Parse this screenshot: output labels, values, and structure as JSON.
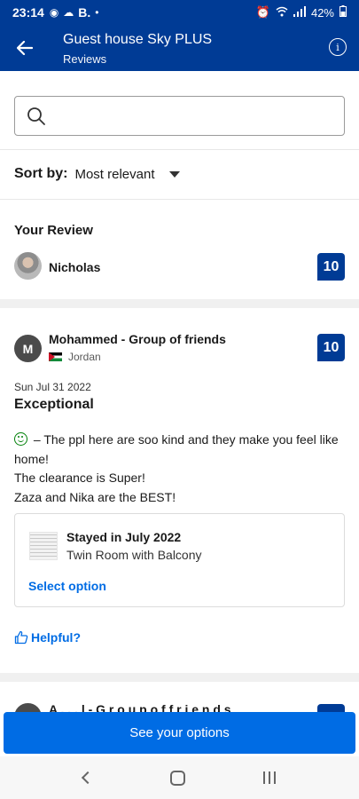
{
  "statusbar": {
    "time": "23:14",
    "notif_letter": "B.",
    "battery": "42%"
  },
  "appbar": {
    "title": "Guest house Sky PLUS",
    "subtitle": "Reviews"
  },
  "search": {
    "placeholder": "",
    "value": ""
  },
  "sort": {
    "label": "Sort by:",
    "value": "Most relevant"
  },
  "your_review": {
    "heading": "Your Review",
    "name": "Nicholas",
    "score": "10"
  },
  "review": {
    "avatar_letter": "M",
    "name": "Mohammed - Group of friends",
    "country": "Jordan",
    "score": "10",
    "date": "Sun Jul 31 2022",
    "headline": "Exceptional",
    "body_line1": " – The ppl here are soo kind and they make you feel like home!",
    "body_line2": "The clearance is Super!",
    "body_line3": "Zaza and Nika are the BEST!",
    "stay": {
      "stayed": "Stayed in July 2022",
      "room": "Twin Room with Balcony",
      "select_label": "Select option"
    },
    "helpful_label": "Helpful?"
  },
  "next_review": {
    "name_partial": "A  . . .  l  -  G r o u p   o f  f r i e n d s"
  },
  "cta": {
    "label": "See your options"
  },
  "colors": {
    "brand_dark": "#003b95",
    "action_blue": "#006ce4",
    "positive_green": "#008009"
  }
}
